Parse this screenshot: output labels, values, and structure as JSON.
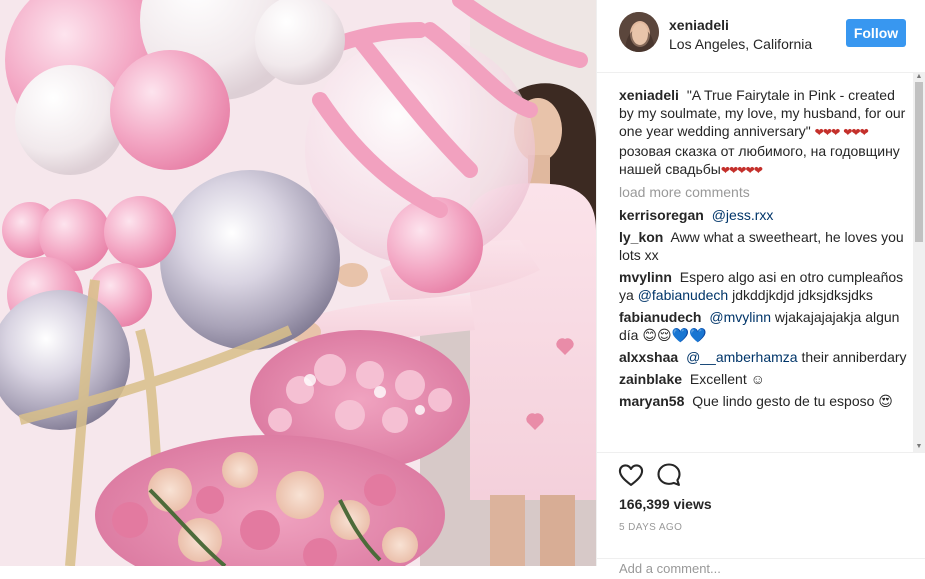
{
  "post": {
    "username": "xeniadeli",
    "location": "Los Angeles, California",
    "follow_label": "Follow"
  },
  "caption": {
    "username": "xeniadeli",
    "text": "\"A True Fairytale in Pink - created by my soulmate, my love, my husband, for our one year wedding anniversary\"",
    "text_ru": "розовая сказка от любимого, на годовщину нашей свадьбы",
    "hearts_1": "❤❤❤",
    "hearts_2": "❤❤❤",
    "hearts_3": "❤❤❤❤❤"
  },
  "load_more": "load more comments",
  "comments": [
    {
      "user": "kerrisoregan",
      "mention": "@jess.rxx",
      "text": ""
    },
    {
      "user": "ly_kon",
      "mention": "",
      "text": "Aww what a sweetheart, he loves you lots xx"
    },
    {
      "user": "mvylinn",
      "mention": "@fabianudech",
      "pre": "Espero algo asi en otro cumpleaños ya",
      "text": "jdkddjkdjd jdksjdksjdks"
    },
    {
      "user": "fabianudech",
      "mention": "@mvylinn",
      "text": "wjakajajajakja algun día 😊😌💙💙"
    },
    {
      "user": "alxxshaa",
      "mention": "@__amberhamza",
      "text": "their anniberdary"
    },
    {
      "user": "zainblake",
      "mention": "",
      "text": "Excellent ☺"
    },
    {
      "user": "maryan58",
      "mention": "",
      "text": "Que lindo gesto de tu esposo 😍"
    }
  ],
  "stats": {
    "views": "166,399 views",
    "time_ago": "5 DAYS AGO"
  },
  "add_comment_placeholder": "Add a comment...",
  "colors": {
    "follow_bg": "#3897f0",
    "mention": "#003569",
    "muted": "#999999"
  },
  "icons": {
    "like": "heart-outline-icon",
    "comment": "speech-bubble-icon"
  }
}
